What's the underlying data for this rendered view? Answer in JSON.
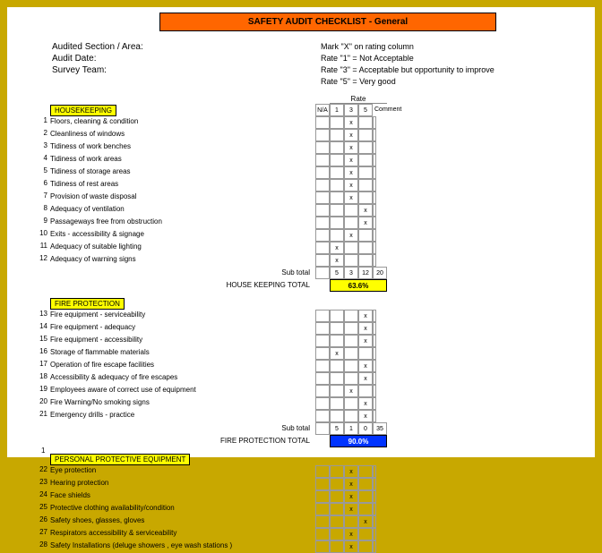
{
  "title": "SAFETY AUDIT CHECKLIST - General",
  "header": {
    "audited_section": "Audited Section / Area:",
    "audit_date": "Audit Date:",
    "survey_team": "Survey Team:",
    "instr1": "Mark \"X\" on rating column",
    "instr2": "Rate \"1\" = Not Acceptable",
    "instr3": "Rate \"3\" = Acceptable but opportunity to improve",
    "instr4": "Rate \"5\" = Very good"
  },
  "colhdr": {
    "rate": "Rate",
    "na": "N/A",
    "c1": "1",
    "c3": "3",
    "c5": "5",
    "comment": "Comment"
  },
  "sections": [
    {
      "name": "HOUSEKEEPING",
      "rows": [
        {
          "n": "1",
          "d": "Floors, cleaning & condition",
          "m": 1
        },
        {
          "n": "2",
          "d": "Cleanliness of windows",
          "m": 1
        },
        {
          "n": "3",
          "d": "Tidiness of work benches",
          "m": 1
        },
        {
          "n": "4",
          "d": "Tidiness of work areas",
          "m": 1
        },
        {
          "n": "5",
          "d": "Tidiness of storage areas",
          "m": 1
        },
        {
          "n": "6",
          "d": "Tidiness of rest areas",
          "m": 1
        },
        {
          "n": "7",
          "d": "Provision of waste disposal",
          "m": 1
        },
        {
          "n": "8",
          "d": "Adequacy of ventilation",
          "m": 2
        },
        {
          "n": "9",
          "d": "Passageways free from obstruction",
          "m": 2
        },
        {
          "n": "10",
          "d": "Exits - accessibility & signage",
          "m": 1
        },
        {
          "n": "11",
          "d": "Adequacy of suitable lighting",
          "m": 0
        },
        {
          "n": "12",
          "d": "Adequacy of warning signs",
          "m": 0
        }
      ],
      "subtotal": {
        "label": "Sub total",
        "v": [
          "",
          "5",
          "3",
          "12",
          "20"
        ]
      },
      "total": {
        "label": "HOUSE KEEPING TOTAL",
        "pct": "63.6%",
        "style": "yellow"
      }
    },
    {
      "name": "FIRE PROTECTION",
      "rows": [
        {
          "n": "13",
          "d": "Fire equipment - serviceability",
          "m": 2
        },
        {
          "n": "14",
          "d": "Fire equipment - adequacy",
          "m": 2
        },
        {
          "n": "15",
          "d": "Fire equipment - accessibility",
          "m": 2
        },
        {
          "n": "16",
          "d": "Storage of flammable materials",
          "m": 0
        },
        {
          "n": "17",
          "d": "Operation of fire escape facilities",
          "m": 2
        },
        {
          "n": "18",
          "d": "Accessibility & adequacy of fire escapes",
          "m": 2
        },
        {
          "n": "19",
          "d": "Employees aware of correct use of equipment",
          "m": 1
        },
        {
          "n": "20",
          "d": "Fire Warning/No smoking signs",
          "m": 2
        },
        {
          "n": "21",
          "d": "Emergency drills - practice",
          "m": 2
        }
      ],
      "subtotal": {
        "label": "Sub total",
        "v": [
          "",
          "5",
          "1",
          "0",
          "35"
        ]
      },
      "total": {
        "label": "FIRE PROTECTION TOTAL",
        "pct": "90.0%",
        "style": "blue"
      }
    },
    {
      "name": "PERSONAL PROTECTIVE EQUIPMENT",
      "rows": [
        {
          "n": "22",
          "d": "Eye protection",
          "m": 1
        },
        {
          "n": "23",
          "d": "Hearing protection",
          "m": 1
        },
        {
          "n": "24",
          "d": "Face shields",
          "m": 1
        },
        {
          "n": "25",
          "d": "Protective clothing availability/condition",
          "m": 1
        },
        {
          "n": "26",
          "d": "Safety shoes, glasses, gloves",
          "m": 2
        },
        {
          "n": "27",
          "d": "Respirators accessibility & serviceability",
          "m": 1
        },
        {
          "n": "28",
          "d": "Safety Installations (deluge showers , eye wash stations )",
          "m": 1
        }
      ]
    }
  ],
  "page_num": "1"
}
